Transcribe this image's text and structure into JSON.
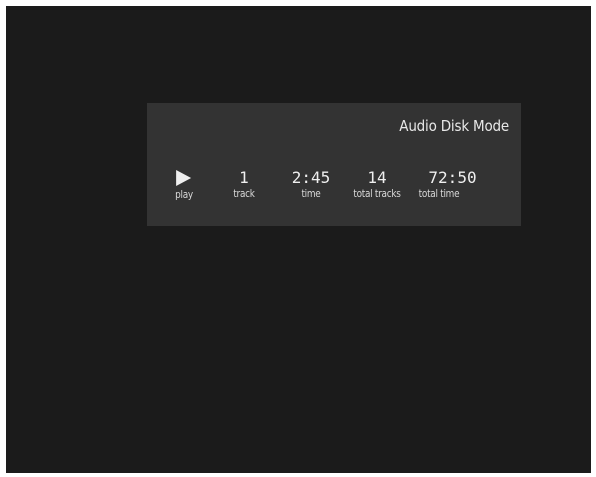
{
  "osd": {
    "mode_label": "Audio Disk Mode",
    "play": {
      "icon": "play-icon",
      "label": "play"
    },
    "track": {
      "value": "1",
      "label": "track"
    },
    "time": {
      "value": "2:45",
      "label": "time"
    },
    "total_tracks": {
      "value": "14",
      "label": "total tracks"
    },
    "total_time": {
      "value": "72:50",
      "label": "total time"
    }
  },
  "colors": {
    "screen_bg": "#1b1b1b",
    "panel_bg": "#333333",
    "text": "#ececec"
  }
}
